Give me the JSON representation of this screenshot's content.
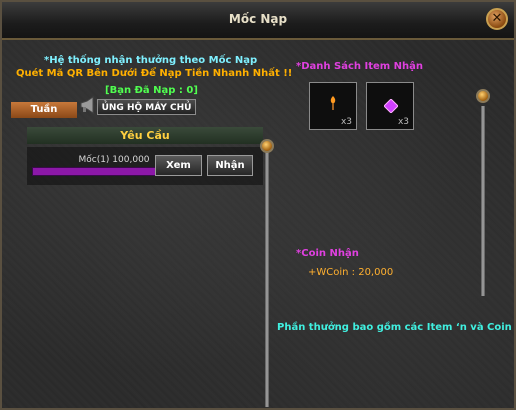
{
  "window": {
    "title": "Mốc Nạp"
  },
  "info": {
    "line1": "*Hệ thống nhận thưởng theo Mốc Nạp",
    "line2": "Quét Mã QR Bên Dưới Để Nạp Tiền Nhanh Nhất !!",
    "paid": "[Bạn Đã Nạp : 0]"
  },
  "tabs": {
    "week": "Tuần"
  },
  "server_button": "ỦNG HỘ MÁY CHỦ",
  "requirement": {
    "header": "Yêu Cầu",
    "milestone": "Mốc(1) 100,000",
    "view_label": "Xem",
    "receive_label": "Nhận"
  },
  "items": {
    "title": "*Danh Sách Item Nhận",
    "list": [
      {
        "icon": "torch-icon",
        "qty": "x3"
      },
      {
        "icon": "purple-gem-icon",
        "qty": "x3"
      }
    ]
  },
  "coin": {
    "title": "*Coin Nhận",
    "value": "+WCoin : 20,000"
  },
  "note": "Phần thưởng bao gồm các Item ‘n và Coin N"
}
